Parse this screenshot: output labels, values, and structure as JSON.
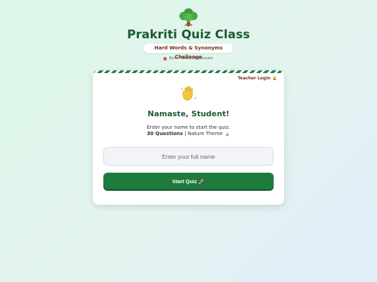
{
  "header": {
    "logo_icon": "tree-icon",
    "title": "Prakriti Quiz Class",
    "subtitle": "Hard Words & Synonyms Challenge",
    "status_text": "Error: Network/Domain",
    "status_color": "#d9534f"
  },
  "card": {
    "teacher_login": "Teacher Login 🔒",
    "wave_icon": "waving-hand-icon",
    "greeting": "Namaste, Student!",
    "instruction": "Enter your name to start the quiz.",
    "question_count": "30 Questions",
    "separator": " | ",
    "theme": "Nature Theme 🍃",
    "name_input": {
      "placeholder": "Enter your full name",
      "value": ""
    },
    "start_button": "Start Quiz 🚀"
  },
  "colors": {
    "primary_green": "#1f7a3d",
    "title_green": "#1d5a32",
    "accent_brown": "#7a2f14"
  }
}
